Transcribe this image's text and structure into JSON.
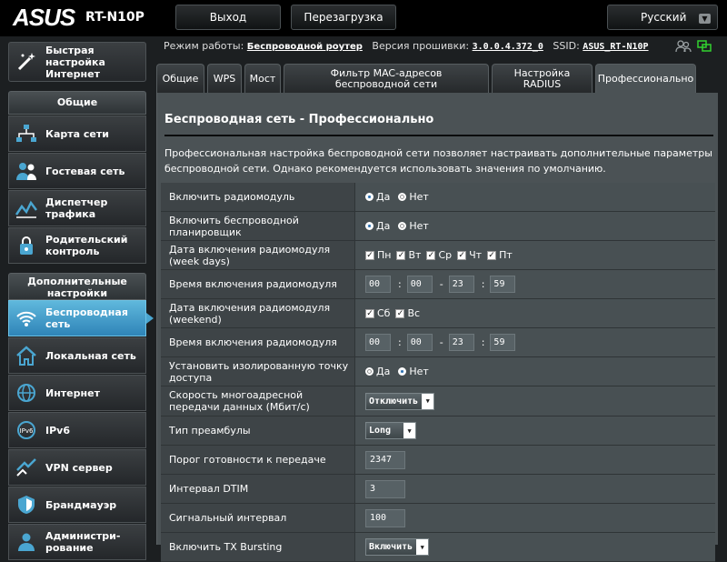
{
  "header": {
    "logo": "ASUS",
    "model": "RT-N10P",
    "logout": "Выход",
    "reboot": "Перезагрузка",
    "language": "Русский"
  },
  "info": {
    "mode_label": "Режим работы:",
    "mode_value": "Беспроводной роутер",
    "fw_label": "Версия прошивки:",
    "fw_value": "3.0.0.4.372_0",
    "ssid_label": "SSID:",
    "ssid_value": "ASUS_RT-N10P"
  },
  "sidebar": {
    "quick_setup": "Быстрая настройка Интернет",
    "general_title": "Общие",
    "general": [
      "Карта сети",
      "Гостевая сеть",
      "Диспетчер трафика",
      "Родительский контроль"
    ],
    "advanced_title": "Дополнительные настройки",
    "advanced": [
      "Беспроводная сеть",
      "Локальная сеть",
      "Интернет",
      "IPv6",
      "VPN сервер",
      "Брандмауэр",
      "Администри-рование"
    ]
  },
  "tabs": [
    "Общие",
    "WPS",
    "Мост",
    "Фильтр MAC-адресов беспроводной сети",
    "Настройка RADIUS",
    "Профессионально"
  ],
  "panel": {
    "title": "Беспроводная сеть - Профессионально",
    "desc": "Профессиональная настройка беспроводной сети позволяет настраивать дополнительные параметры беспроводной сети. Однако рекомендуется использовать значения по умолчанию."
  },
  "labels": {
    "yes": "Да",
    "no": "Нет"
  },
  "rows": {
    "radio": "Включить радиомодуль",
    "scheduler": "Включить беспроводной планировщик",
    "weekdays": "Дата включения радиомодуля (week days)",
    "time1": "Время включения радиомодуля",
    "weekend": "Дата включения радиомодуля (weekend)",
    "time2": "Время включения радиомодуля",
    "isolate": "Установить изолированную точку доступа",
    "mcast": "Скорость многоадресной передачи данных (Мбит/с)",
    "preamble": "Тип преамбулы",
    "rts": "Порог готовности к передаче",
    "dtim": "Интервал DTIM",
    "beacon": "Сигнальный интервал",
    "txburst": "Включить TX Bursting"
  },
  "days_week": [
    "Пн",
    "Вт",
    "Ср",
    "Чт",
    "Пт"
  ],
  "days_weekend": [
    "Сб",
    "Вс"
  ],
  "time1": [
    "00",
    "00",
    "23",
    "59"
  ],
  "time2": [
    "00",
    "00",
    "23",
    "59"
  ],
  "values": {
    "mcast": "Отключить",
    "preamble": "Long",
    "rts": "2347",
    "dtim": "3",
    "beacon": "100",
    "txburst": "Включить"
  },
  "colors": {
    "accent": "#4aa6d1",
    "panel": "#4b5255",
    "active_radio": "#2a6fb0"
  }
}
